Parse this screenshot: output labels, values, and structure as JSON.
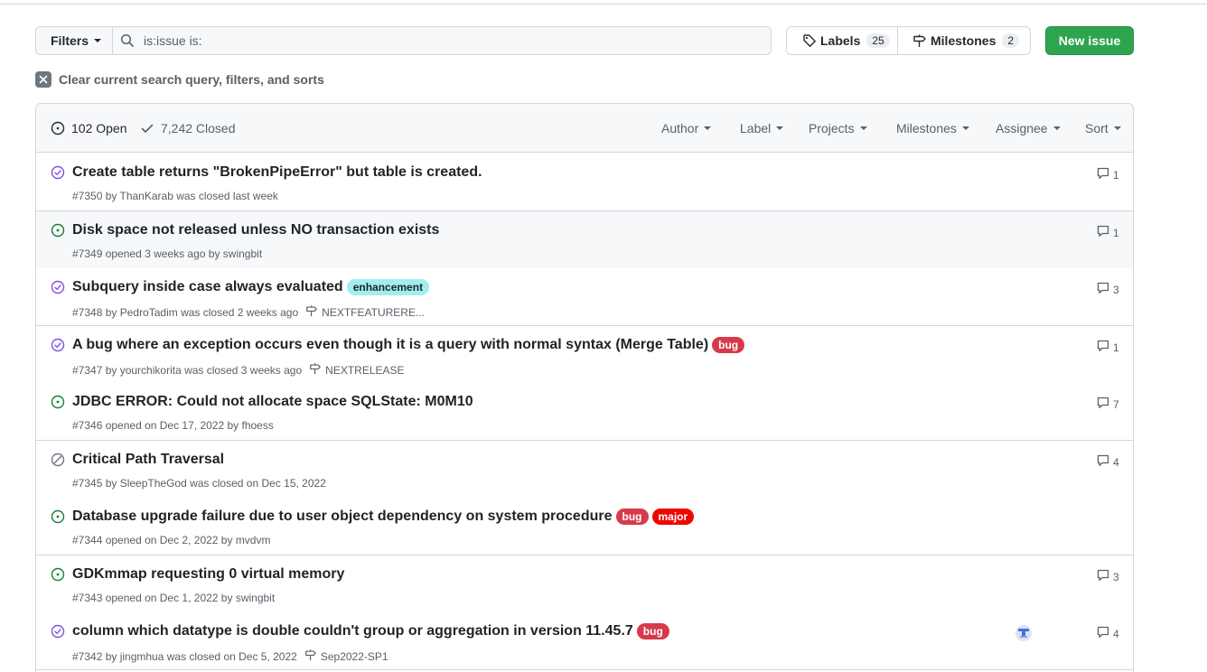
{
  "toolbar": {
    "filters_label": "Filters",
    "search_value": "is:issue is:",
    "labels_label": "Labels",
    "labels_count": "25",
    "milestones_label": "Milestones",
    "milestones_count": "2",
    "new_issue_label": "New issue",
    "clear_query_label": "Clear current search query, filters, and sorts"
  },
  "header": {
    "open_label": "102 Open",
    "closed_label": "7,242 Closed",
    "filters": [
      "Author",
      "Label",
      "Projects",
      "Milestones",
      "Assignee",
      "Sort"
    ]
  },
  "colors": {
    "open_icon": "#1a7f37",
    "closed_icon": "#8250df",
    "not_planned_icon": "#6e7781",
    "primary_button": "#2da44e"
  },
  "issues": [
    {
      "title": "Create table returns \"BrokenPipeError\" but table is created.",
      "meta": "#7350 by ThanKarab was closed last week",
      "state": "closed",
      "labels": [],
      "milestone": "",
      "comments": "1"
    },
    {
      "title": "Disk space not released unless NO transaction exists",
      "meta": "#7349 opened 3 weeks ago by swingbit",
      "state": "open",
      "labels": [],
      "milestone": "",
      "comments": "1"
    },
    {
      "title": "Subquery inside case always evaluated",
      "meta": "#7348 by PedroTadim was closed 2 weeks ago",
      "state": "closed",
      "labels": [
        "enhancement"
      ],
      "milestone": "NEXTFEATURERE...",
      "comments": "3"
    },
    {
      "title": "A bug where an exception occurs even though it is a query with normal syntax (Merge Table)",
      "meta": "#7347 by yourchikorita was closed 3 weeks ago",
      "state": "closed",
      "labels": [
        "bug"
      ],
      "milestone": "NEXTRELEASE",
      "comments": "1"
    },
    {
      "title": "JDBC ERROR: Could not allocate space SQLState: M0M10",
      "meta": "#7346 opened on Dec 17, 2022 by fhoess",
      "state": "open",
      "labels": [],
      "milestone": "",
      "comments": "7"
    },
    {
      "title": "Critical Path Traversal",
      "meta": "#7345 by SleepTheGod was closed on Dec 15, 2022",
      "state": "not-planned",
      "labels": [],
      "milestone": "",
      "comments": "4"
    },
    {
      "title": "Database upgrade failure due to user object dependency on system procedure",
      "meta": "#7344 opened on Dec 2, 2022 by mvdvm",
      "state": "open",
      "labels": [
        "bug",
        "major"
      ],
      "milestone": "",
      "comments": ""
    },
    {
      "title": "GDKmmap requesting 0 virtual memory",
      "meta": "#7343 opened on Dec 1, 2022 by swingbit",
      "state": "open",
      "labels": [],
      "milestone": "",
      "comments": "3"
    },
    {
      "title": "column which datatype is double couldn't group or aggregation in version 11.45.7",
      "meta": "#7342 by jingmhua was closed on Dec 5, 2022",
      "state": "closed",
      "labels": [
        "bug"
      ],
      "milestone": "Sep2022-SP1",
      "comments": "4",
      "assignee_avatar": true
    }
  ]
}
